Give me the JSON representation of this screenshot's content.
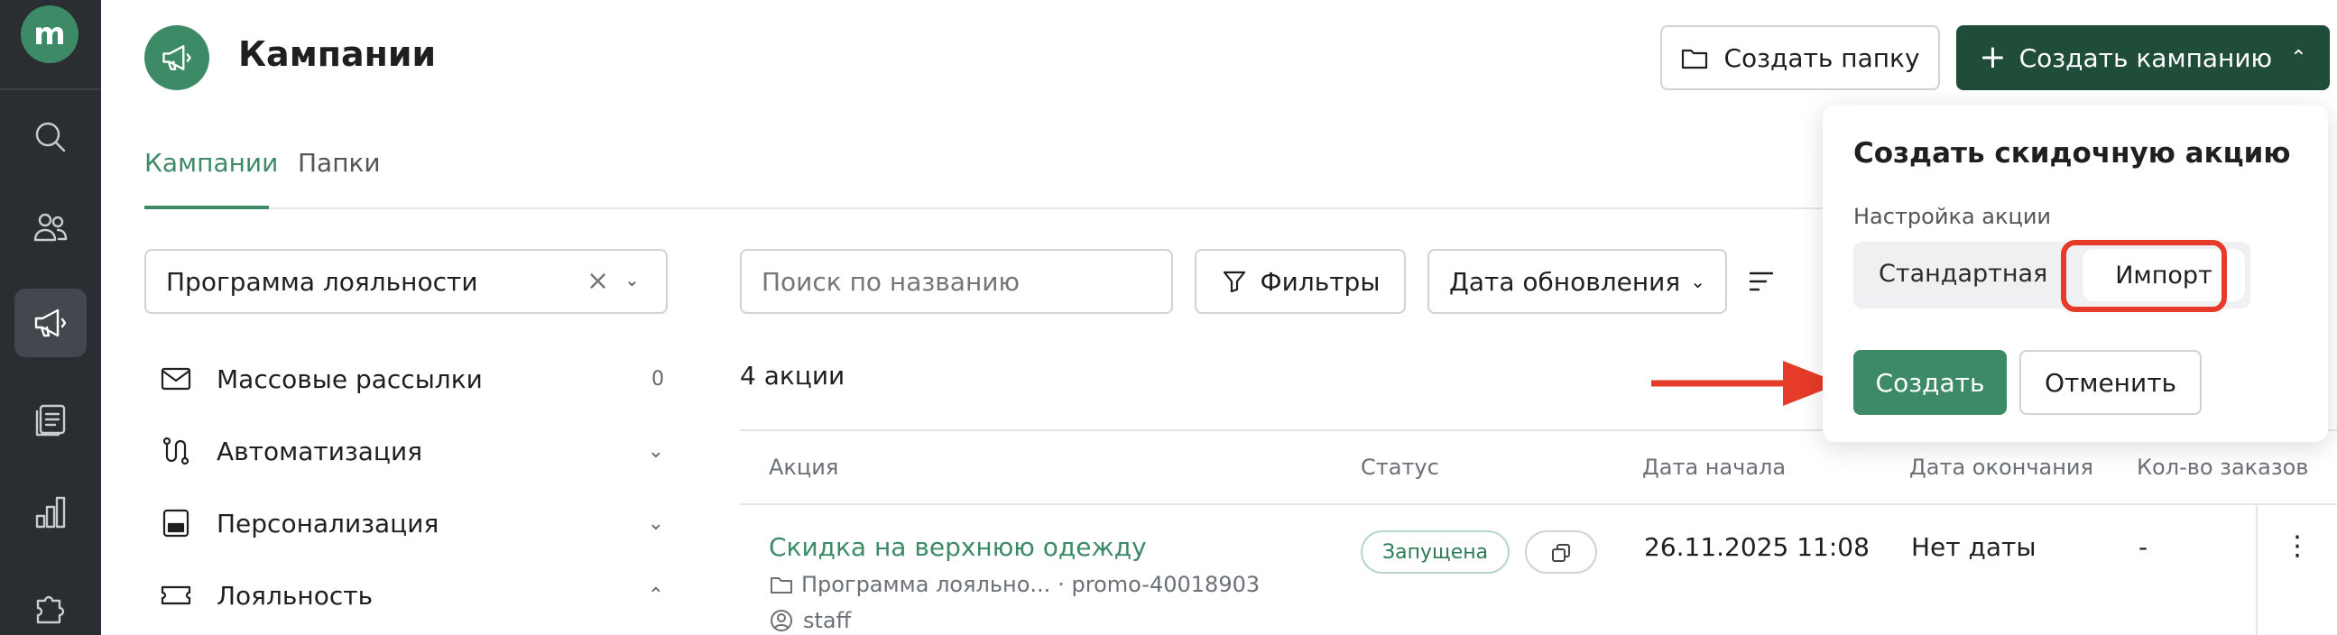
{
  "app": {
    "logo_letter": "m"
  },
  "header": {
    "title": "Кампании",
    "create_folder_label": "Создать папку",
    "create_campaign_label": "Создать кампанию"
  },
  "tabs": [
    {
      "label": "Кампании",
      "active": true
    },
    {
      "label": "Папки",
      "active": false
    }
  ],
  "filters": {
    "program_select": "Программа лояльности",
    "search_placeholder": "Поиск по названию",
    "filter_label": "Фильтры",
    "sort_label": "Дата обновления"
  },
  "nav": [
    {
      "label": "Массовые рассылки",
      "count": "0",
      "icon": "mail-icon"
    },
    {
      "label": "Автоматизация",
      "icon": "flow-icon",
      "chevron": "down"
    },
    {
      "label": "Персонализация",
      "icon": "personalization-icon",
      "chevron": "down"
    },
    {
      "label": "Лояльность",
      "icon": "ticket-icon",
      "chevron": "up"
    }
  ],
  "list": {
    "count_label": "4 акции",
    "columns": [
      "Акция",
      "Статус",
      "Дата начала",
      "Дата окончания",
      "Кол-во заказов"
    ],
    "rows": [
      {
        "title": "Скидка на верхнюю одежду",
        "folder": "Программа лояльно...",
        "code": "· promo-40018903",
        "author": "staff",
        "status": "Запущена",
        "start": "26.11.2025 11:08",
        "end": "Нет даты",
        "orders": "-"
      }
    ]
  },
  "popup": {
    "title": "Создать скидочную акцию",
    "subtitle": "Настройка акции",
    "option_standard": "Стандартная",
    "option_import": "Импорт",
    "create_label": "Создать",
    "cancel_label": "Отменить"
  },
  "colors": {
    "brand": "#3d8a67",
    "brand_dark": "#1f4d39",
    "sidebar": "#2a2d31",
    "highlight": "#e53b28"
  }
}
